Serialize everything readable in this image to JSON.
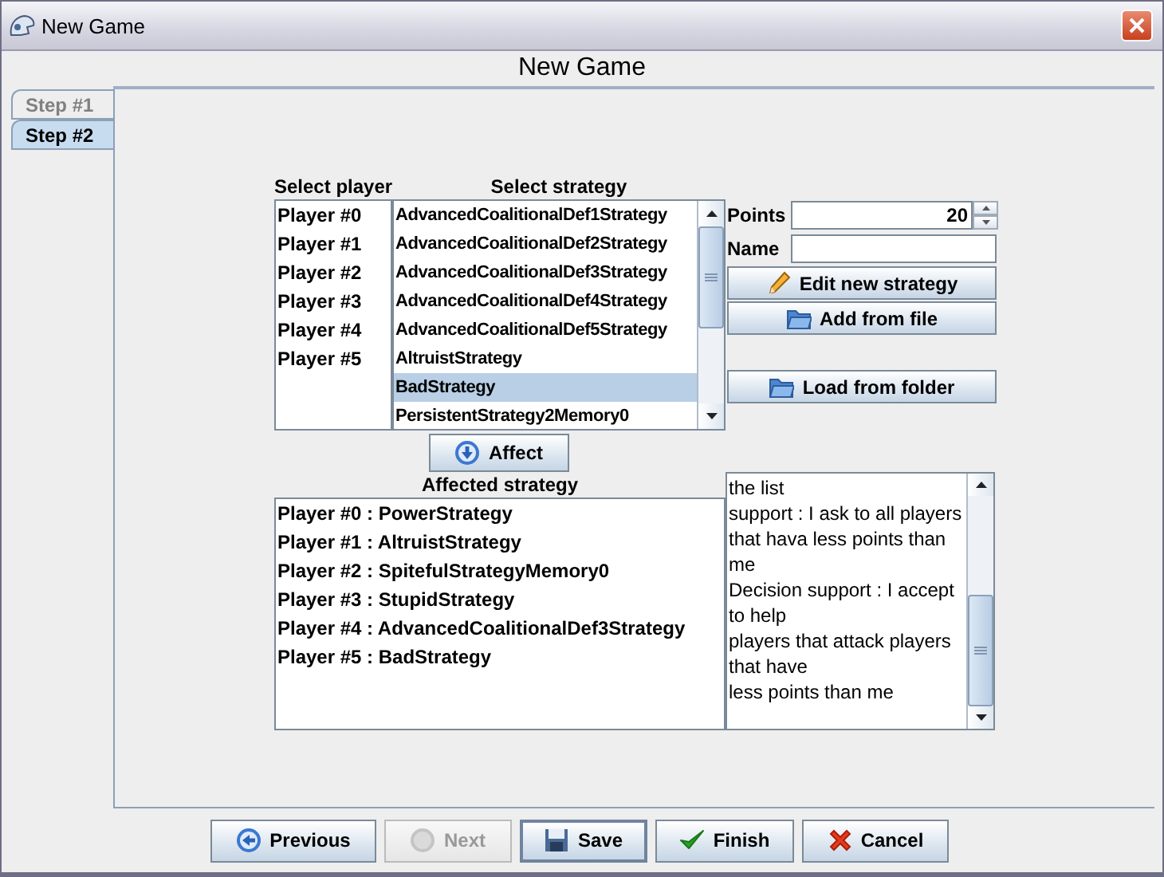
{
  "window": {
    "title": "New Game"
  },
  "header": "New Game",
  "tabs": [
    {
      "label": "Step #1",
      "selected": false
    },
    {
      "label": "Step #2",
      "selected": true
    }
  ],
  "player_list": {
    "label": "Select player",
    "items": [
      {
        "label": "Player #0",
        "selected": false
      },
      {
        "label": "Player #1",
        "selected": false
      },
      {
        "label": "Player #2",
        "selected": false
      },
      {
        "label": "Player #3",
        "selected": false
      },
      {
        "label": "Player #4",
        "selected": false
      },
      {
        "label": "Player #5",
        "selected": false
      }
    ]
  },
  "strategy_list": {
    "label": "Select strategy",
    "items": [
      {
        "label": "AdvancedCoalitionalDef1Strategy",
        "selected": false
      },
      {
        "label": "AdvancedCoalitionalDef2Strategy",
        "selected": false
      },
      {
        "label": "AdvancedCoalitionalDef3Strategy",
        "selected": false
      },
      {
        "label": "AdvancedCoalitionalDef4Strategy",
        "selected": false
      },
      {
        "label": "AdvancedCoalitionalDef5Strategy",
        "selected": false
      },
      {
        "label": "AltruistStrategy",
        "selected": false
      },
      {
        "label": "BadStrategy",
        "selected": true
      },
      {
        "label": "PersistentStrategy2Memory0",
        "selected": false
      }
    ]
  },
  "points": {
    "label": "Points",
    "value": "20"
  },
  "name": {
    "label": "Name"
  },
  "strategy_buttons": [
    {
      "label": "Edit new strategy"
    },
    {
      "label": "Add from file"
    },
    {
      "label": "Load from folder"
    }
  ],
  "affect_button": {
    "label": "Affect"
  },
  "affected_list": {
    "label": "Affected strategy",
    "items": [
      "Player #0 : PowerStrategy",
      "Player #1 : AltruistStrategy",
      "Player #2 : SpitefulStrategyMemory0",
      "Player #3 : StupidStrategy",
      "Player #4 : AdvancedCoalitionalDef3Strategy",
      "Player #5 : BadStrategy"
    ]
  },
  "description": {
    "lines": [
      "the list",
      "support : I ask to all players",
      "that hava less points than",
      "me",
      "Decision support : I accept",
      "to help",
      "players that attack players",
      "that have",
      "less points than me"
    ]
  },
  "footer_buttons": [
    {
      "label": "Previous",
      "disabled": false,
      "focused": false
    },
    {
      "label": "Next",
      "disabled": true,
      "focused": false
    },
    {
      "label": "Save",
      "disabled": false,
      "focused": true
    },
    {
      "label": "Finish",
      "disabled": false,
      "focused": false
    },
    {
      "label": "Cancel",
      "disabled": false,
      "focused": false
    }
  ]
}
